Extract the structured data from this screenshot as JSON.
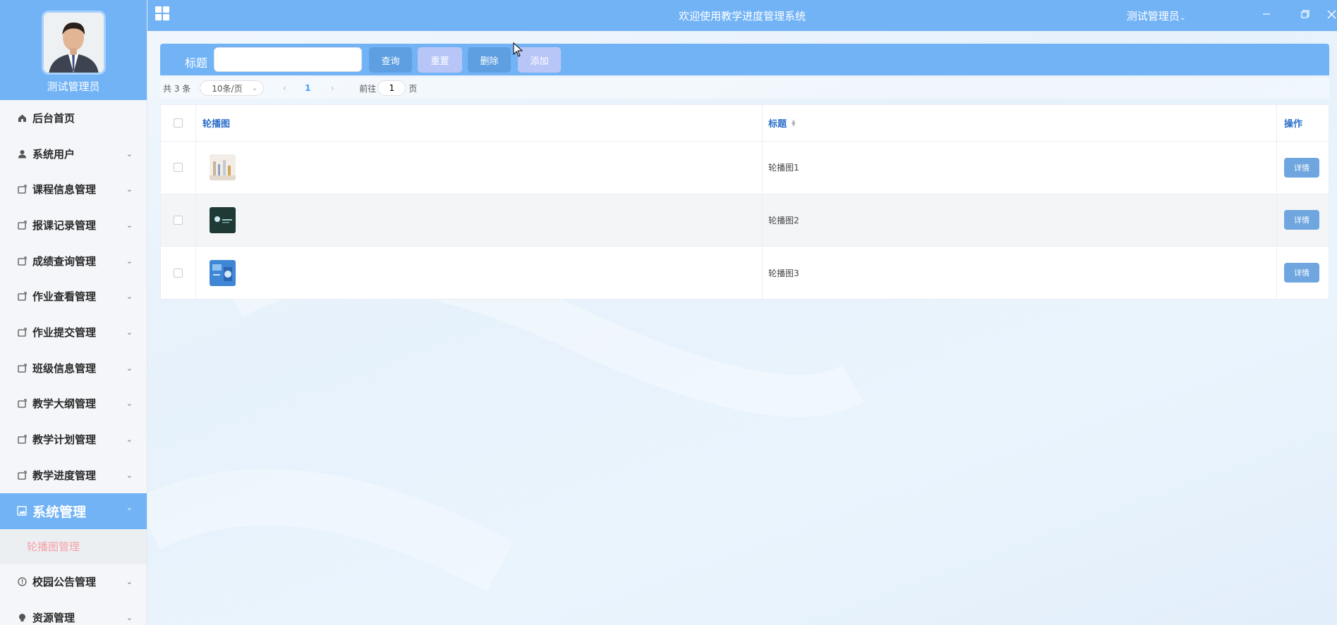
{
  "sidebar": {
    "user_name": "测试管理员",
    "items": [
      {
        "label": "后台首页",
        "icon": "home-icon"
      },
      {
        "label": "系统用户",
        "icon": "user-icon"
      },
      {
        "label": "课程信息管理",
        "icon": "folder-icon"
      },
      {
        "label": "报课记录管理",
        "icon": "folder-icon"
      },
      {
        "label": "成绩查询管理",
        "icon": "folder-icon"
      },
      {
        "label": "作业查看管理",
        "icon": "folder-icon"
      },
      {
        "label": "作业提交管理",
        "icon": "folder-icon"
      },
      {
        "label": "班级信息管理",
        "icon": "folder-icon"
      },
      {
        "label": "教学大纲管理",
        "icon": "folder-icon"
      },
      {
        "label": "教学计划管理",
        "icon": "folder-icon"
      },
      {
        "label": "教学进度管理",
        "icon": "folder-icon"
      }
    ],
    "active": {
      "label": "系统管理",
      "icon": "picture-icon"
    },
    "active_sub": {
      "label": "轮播图管理"
    },
    "after": [
      {
        "label": "校园公告管理",
        "icon": "info-icon"
      },
      {
        "label": "资源管理",
        "icon": "bulb-icon"
      }
    ]
  },
  "topbar": {
    "title": "欢迎使用教学进度管理系统",
    "user_menu": "测试管理员",
    "user_menu_caret": "⌄"
  },
  "search": {
    "label": "标题",
    "placeholder": "",
    "value": "",
    "query_label": "查询",
    "reset_label": "重置",
    "delete_label": "删除",
    "add_label": "添加"
  },
  "pagination": {
    "total": "共 3 条",
    "page_size": "10条/页",
    "current_page": "1",
    "goto_label": "前往",
    "goto_value": "1",
    "page_suffix": "页"
  },
  "table": {
    "headers": {
      "image": "轮播图",
      "title": "标题",
      "operation": "操作"
    },
    "rows": [
      {
        "title": "轮播图1",
        "action": "详情"
      },
      {
        "title": "轮播图2",
        "action": "详情"
      },
      {
        "title": "轮播图3",
        "action": "详情"
      }
    ]
  },
  "colors": {
    "primary": "#72b3f6",
    "link": "#2c6fc9",
    "sub_active_text": "#f7a0a8"
  }
}
